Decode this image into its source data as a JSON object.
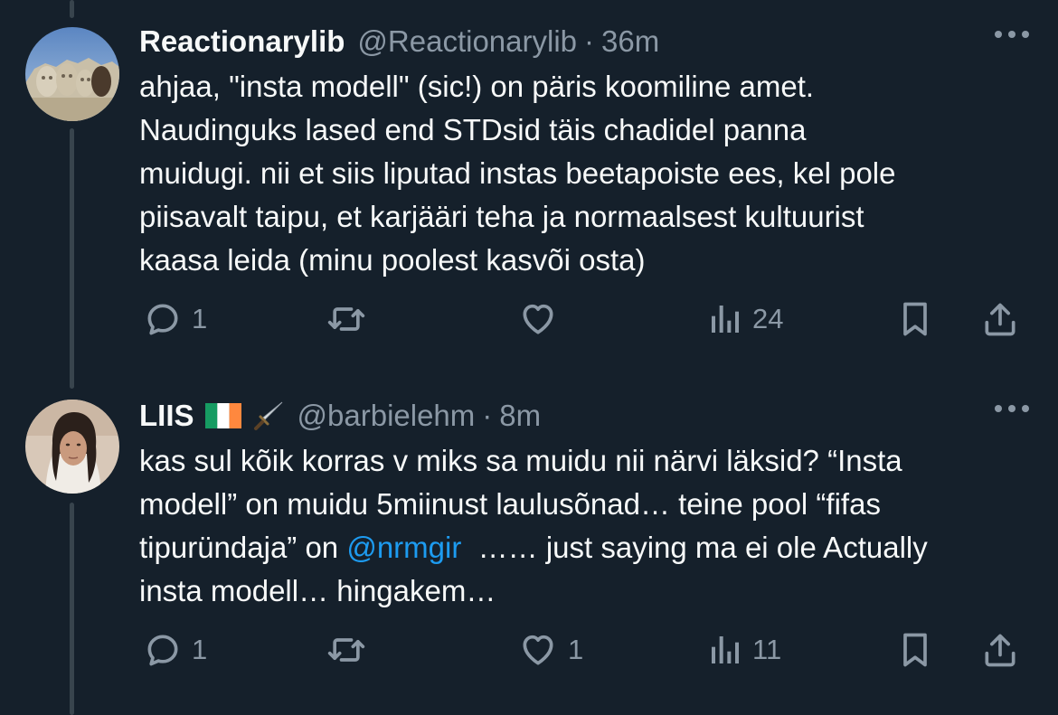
{
  "tweets": [
    {
      "name": "Reactionarylib",
      "handle": "@Reactionarylib",
      "separator": "·",
      "time": "36m",
      "lines": [
        "ahjaa, \"insta modell\" (sic!) on päris koomiline amet.",
        "Naudinguks lased end STDsid täis chadidel panna",
        "muidugi. nii et siis liputad instas beetapoiste ees, kel pole",
        "piisavalt taipu, et karjääri teha ja normaalsest kultuurist",
        "kaasa leida (minu poolest kasvõi osta)"
      ],
      "replies": "1",
      "retweets": "",
      "likes": "",
      "views": "24"
    },
    {
      "name": "LIIS",
      "handle": "@barbielehm",
      "separator": "·",
      "time": "8m",
      "lines": [
        "kas sul kõik korras v miks sa muidu nii närvi läksid?  “Insta",
        "modell” on muidu 5miinust laulusõnad… teine pool “fifas",
        "insta modell… hingakem…"
      ],
      "line3_before": "tipuründaja” on ",
      "mention": "@nrmgir",
      "line3_after": "  …… just saying ma ei ole Actually",
      "replies": "1",
      "retweets": "",
      "likes": "1",
      "views": "11"
    }
  ],
  "icons": {
    "reply": "reply-bubble-icon",
    "retweet": "retweet-arrows-icon",
    "like": "heart-icon",
    "views": "bar-chart-icon",
    "bookmark": "bookmark-icon",
    "share": "share-upload-icon",
    "more": "more-dots-icon"
  },
  "colors": {
    "background": "#15202b",
    "text": "#f7f9f9",
    "muted": "#8b98a5",
    "link": "#1d9bf0",
    "thread_line": "#38444d"
  }
}
